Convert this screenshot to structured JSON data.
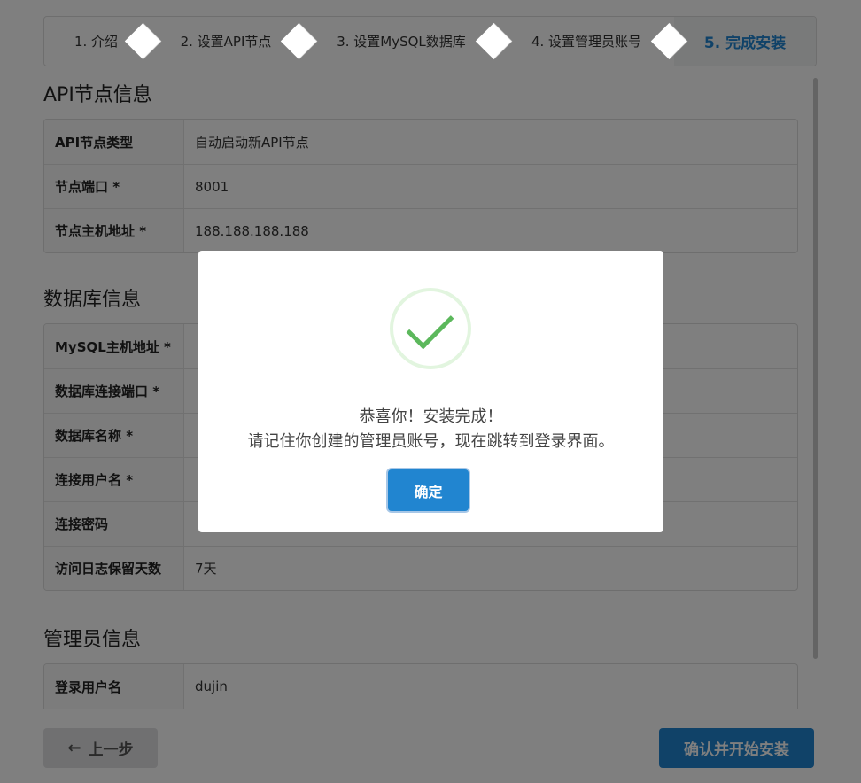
{
  "steps": [
    {
      "label": "1. 介绍"
    },
    {
      "label": "2. 设置API节点"
    },
    {
      "label": "3. 设置MySQL数据库"
    },
    {
      "label": "4. 设置管理员账号"
    },
    {
      "label": "5. 完成安装"
    }
  ],
  "api_section": {
    "title": "API节点信息",
    "rows": [
      {
        "key": "API节点类型",
        "value": "自动启动新API节点"
      },
      {
        "key": "节点端口 *",
        "value": "8001"
      },
      {
        "key": "节点主机地址 *",
        "value": "188.188.188.188"
      }
    ]
  },
  "db_section": {
    "title": "数据库信息",
    "rows": [
      {
        "key": "MySQL主机地址 *",
        "value": ""
      },
      {
        "key": "数据库连接端口 *",
        "value": ""
      },
      {
        "key": "数据库名称 *",
        "value": ""
      },
      {
        "key": "连接用户名 *",
        "value": ""
      },
      {
        "key": "连接密码",
        "value": ""
      },
      {
        "key": "访问日志保留天数",
        "value": "7天"
      }
    ]
  },
  "admin_section": {
    "title": "管理员信息",
    "rows": [
      {
        "key": "登录用户名",
        "value": "dujin"
      }
    ]
  },
  "footer": {
    "back_label": "上一步",
    "back_icon": "arrow-left-icon",
    "submit_label": "确认并开始安装"
  },
  "modal": {
    "icon": "checkmark-icon",
    "icon_color": "#5cb85c",
    "line1": "恭喜你！安装完成！",
    "line2": "请记住你创建的管理员账号，现在跳转到登录界面。",
    "ok_label": "确定"
  },
  "colors": {
    "primary": "#2185d0"
  }
}
